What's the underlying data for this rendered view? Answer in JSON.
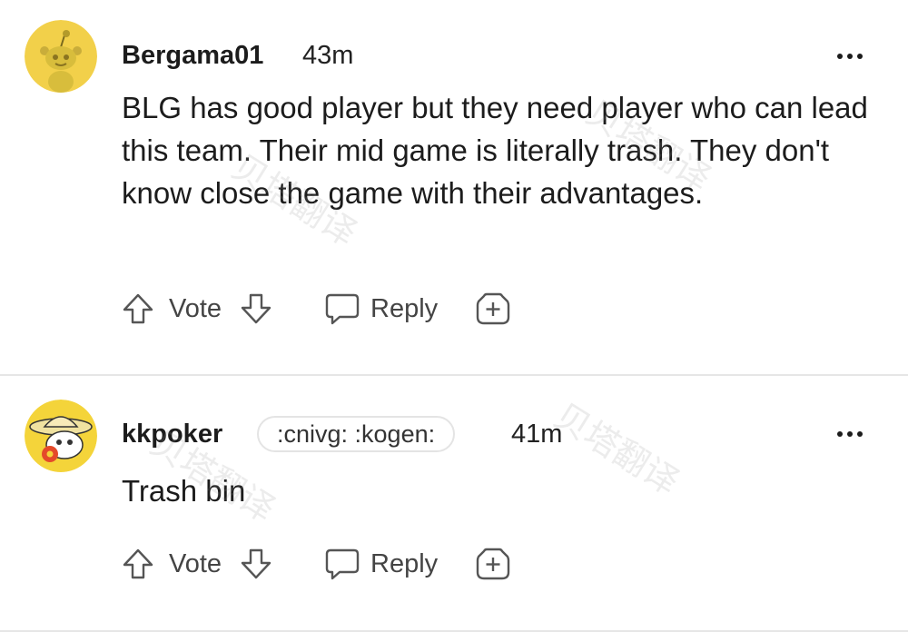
{
  "comments": [
    {
      "username": "Bergama01",
      "time": "43m",
      "flair": "",
      "text": "BLG has good player but they need player who can lead this team. Their mid game is literally trash. They don't know close the game with their advantages.",
      "actions": {
        "vote": "Vote",
        "reply": "Reply"
      },
      "avatar_color": "#f2d04a"
    },
    {
      "username": "kkpoker",
      "time": "41m",
      "flair": ":cnivg: :kogen:",
      "text": "Trash bin",
      "actions": {
        "vote": "Vote",
        "reply": "Reply"
      },
      "avatar_color": "#f4d43a"
    }
  ],
  "watermark": "贝塔翻译",
  "colors": {
    "text": "#1c1c1c",
    "muted": "#444444",
    "divider": "#e6e6e6",
    "avatar_yellow": "#f2d04a"
  },
  "icons": {
    "upvote": "arrow-up-icon",
    "downvote": "arrow-down-icon",
    "reply": "speech-bubble-icon",
    "award": "plus-square-icon",
    "more": "ellipsis-icon"
  }
}
